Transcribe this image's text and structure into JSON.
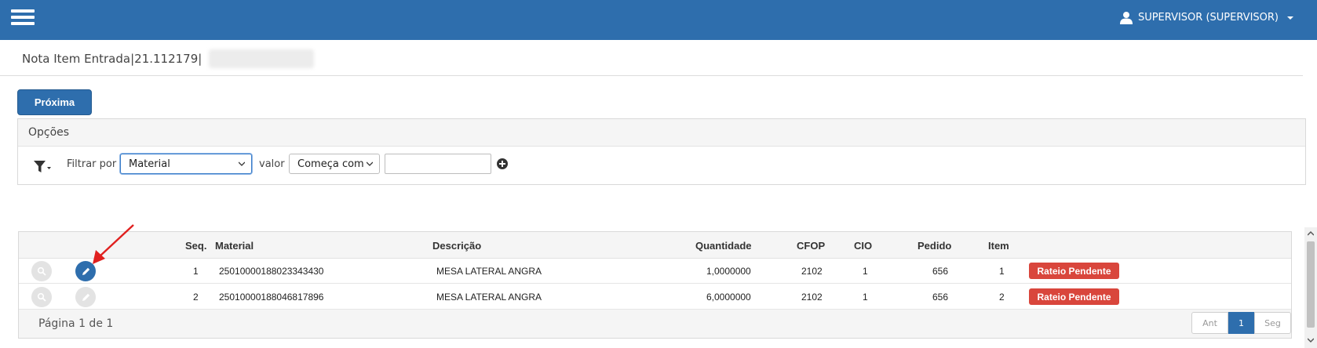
{
  "header": {
    "user_label": "SUPERVISOR (SUPERVISOR)"
  },
  "page": {
    "title": "Nota Item Entrada|21.112179|"
  },
  "toolbar": {
    "next_label": "Próxima"
  },
  "options": {
    "title": "Opções",
    "filter_by_label": "Filtrar por",
    "filter_field_value": "Material",
    "value_label": "valor",
    "operator_value": "Começa com",
    "search_value": ""
  },
  "table": {
    "columns": [
      "Seq.",
      "Material",
      "Descrição",
      "Quantidade",
      "CFOP",
      "CIO",
      "Pedido",
      "Item"
    ],
    "rows": [
      {
        "seq": "1",
        "material": "25010000188023343430",
        "descricao": "MESA LATERAL ANGRA",
        "quantidade": "1,0000000",
        "cfop": "2102",
        "cio": "1",
        "pedido": "656",
        "item": "1",
        "status": "Rateio Pendente"
      },
      {
        "seq": "2",
        "material": "25010000188046817896",
        "descricao": "MESA LATERAL ANGRA",
        "quantidade": "6,0000000",
        "cfop": "2102",
        "cio": "1",
        "pedido": "656",
        "item": "2",
        "status": "Rateio Pendente"
      }
    ]
  },
  "pagination": {
    "info": "Página 1 de 1",
    "prev_label": "Ant",
    "current_page": "1",
    "next_label": "Seg"
  },
  "icons": {
    "menu": "hamburger-icon",
    "user": "user-icon",
    "filter": "filter-icon",
    "add": "plus-circle-icon",
    "view": "search-icon",
    "edit": "pencil-icon",
    "annotation": "red-arrow-annotation"
  },
  "colors": {
    "primary": "#2e6ead",
    "status_badge": "#d9463c"
  }
}
